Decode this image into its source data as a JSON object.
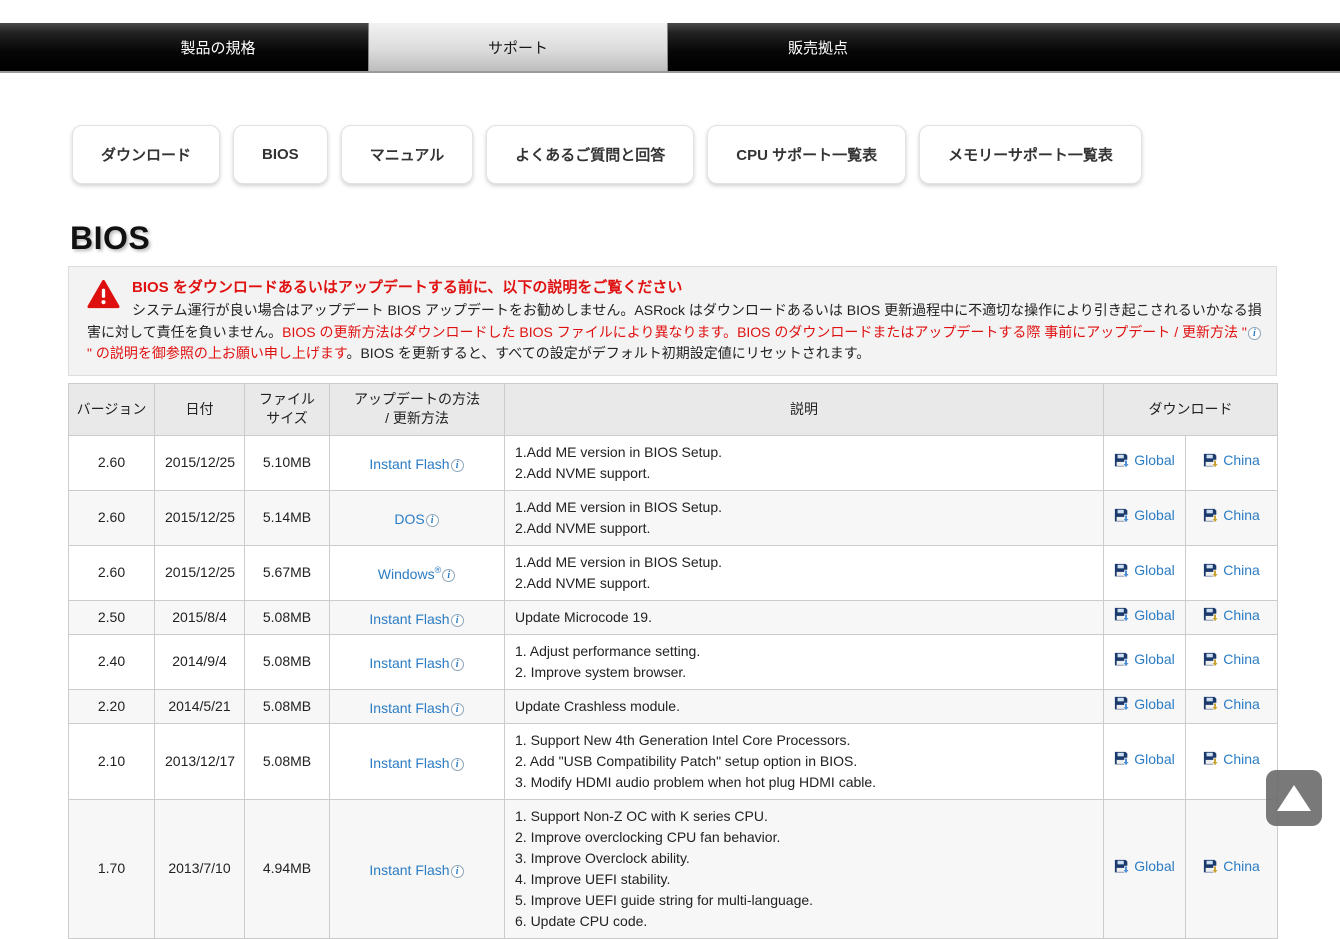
{
  "nav": {
    "tabs": [
      {
        "label": "製品の規格",
        "active": false
      },
      {
        "label": "サポート",
        "active": true
      },
      {
        "label": "販売拠点",
        "active": false
      }
    ]
  },
  "support_buttons": [
    {
      "label": "ダウンロード"
    },
    {
      "label": "BIOS"
    },
    {
      "label": "マニュアル"
    },
    {
      "label": "よくあるご質問と回答"
    },
    {
      "label": "CPU サポート一覧表"
    },
    {
      "label": "メモリーサポート一覧表"
    }
  ],
  "page_title": "BIOS",
  "warning": {
    "title": "BIOS をダウンロードあるいはアップデートする前に、以下の説明をご覧ください",
    "body_black_1": "システム運行が良い場合はアップデート BIOS アップデートをお勧めしません。ASRock はダウンロードあるいは BIOS 更新過程中に不適切な操作により引き起こされるいかなる損害に対して責任を負いません。",
    "body_red_1": "BIOS の更新方法はダウンロードした BIOS ファイルにより異なります。BIOS のダウンロードまたはアップデートする際 事前にアップデート / 更新方法 \"",
    "body_red_2": "\" の説明を御参照の上お願い申し上げます",
    "body_black_2": "。BIOS を更新すると、すべての設定がデフォルト初期設定値にリセットされます。"
  },
  "icons": {
    "info_glyph": "i"
  },
  "table": {
    "headers": {
      "version": "バージョン",
      "date": "日付",
      "file_size": "ファイル\nサイズ",
      "update_method": "アップデートの方法\n/ 更新方法",
      "description": "説明",
      "download": "ダウンロード"
    },
    "rows": [
      {
        "version": "2.60",
        "date": "2015/12/25",
        "size": "5.10MB",
        "method": "Instant Flash",
        "mark": "",
        "description": "1.Add ME version in BIOS Setup.\n2.Add NVME support.",
        "global_label": "Global",
        "china_label": "China"
      },
      {
        "version": "2.60",
        "date": "2015/12/25",
        "size": "5.14MB",
        "method": "DOS",
        "mark": "",
        "description": "1.Add ME version in BIOS Setup.\n2.Add NVME support.",
        "global_label": "Global",
        "china_label": "China"
      },
      {
        "version": "2.60",
        "date": "2015/12/25",
        "size": "5.67MB",
        "method": "Windows",
        "mark": "®",
        "description": "1.Add ME version in BIOS Setup.\n2.Add NVME support.",
        "global_label": "Global",
        "china_label": "China"
      },
      {
        "version": "2.50",
        "date": "2015/8/4",
        "size": "5.08MB",
        "method": "Instant Flash",
        "mark": "",
        "description": "Update Microcode 19.",
        "global_label": "Global",
        "china_label": "China"
      },
      {
        "version": "2.40",
        "date": "2014/9/4",
        "size": "5.08MB",
        "method": "Instant Flash",
        "mark": "",
        "description": "1. Adjust performance setting.\n2. Improve system browser.",
        "global_label": "Global",
        "china_label": "China"
      },
      {
        "version": "2.20",
        "date": "2014/5/21",
        "size": "5.08MB",
        "method": "Instant Flash",
        "mark": "",
        "description": "Update Crashless module.",
        "global_label": "Global",
        "china_label": "China"
      },
      {
        "version": "2.10",
        "date": "2013/12/17",
        "size": "5.08MB",
        "method": "Instant Flash",
        "mark": "",
        "description": "1. Support New 4th Generation Intel Core Processors.\n2. Add \"USB Compatibility Patch\" setup option in BIOS.\n3. Modify HDMI audio problem when hot plug HDMI cable.",
        "global_label": "Global",
        "china_label": "China"
      },
      {
        "version": "1.70",
        "date": "2013/7/10",
        "size": "4.94MB",
        "method": "Instant Flash",
        "mark": "",
        "description": "1. Support Non-Z OC with K series CPU.\n2. Improve overclocking CPU fan behavior.\n3. Improve Overclock ability.\n4. Improve UEFI stability.\n5. Improve UEFI guide string for multi-language.\n6. Update CPU code.",
        "global_label": "Global",
        "china_label": "China"
      }
    ]
  },
  "colors": {
    "accent_red": "#e01111",
    "link_blue": "#2b7cc4"
  }
}
